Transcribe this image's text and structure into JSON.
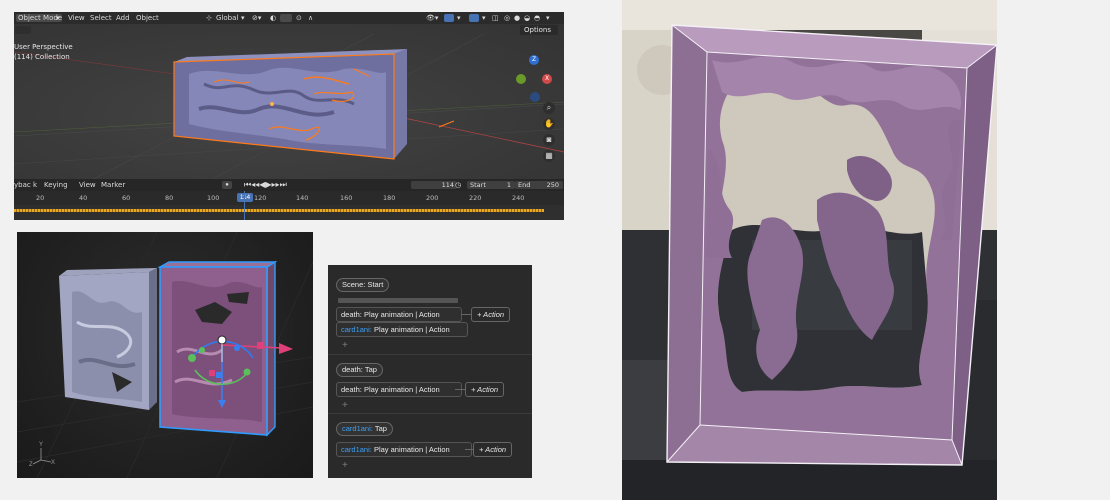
{
  "blender": {
    "header": {
      "mode": "Object Mode",
      "menus": [
        "View",
        "Select",
        "Add",
        "Object"
      ],
      "orientation": "Global",
      "options": "Options"
    },
    "viewport": {
      "view_name": "User Perspective",
      "collection": "(114) Collection",
      "gizmo": {
        "z": "Z",
        "x": "X"
      }
    },
    "timeline": {
      "menus": [
        "ybac k",
        "Keying",
        "View",
        "Marker"
      ],
      "current_frame": "114",
      "start_label": "Start",
      "start_value": "1",
      "end_label": "End",
      "end_value": "250",
      "ruler_ticks": [
        "20",
        "40",
        "60",
        "80",
        "100",
        "120",
        "140",
        "160",
        "180",
        "200",
        "220",
        "240"
      ],
      "cursor_label": "114"
    }
  },
  "model_view": {
    "axis": {
      "y": "Y",
      "z": "Z",
      "x": "X"
    }
  },
  "behaviors": {
    "sections": [
      {
        "trigger_label": "Scene:",
        "trigger_value": "Start",
        "actions": [
          {
            "object": "death:",
            "text": "Play animation | Action"
          },
          {
            "object": "card1ani:",
            "text": "Play animation | Action"
          }
        ],
        "add_action": "+ Action"
      },
      {
        "trigger_label": "death:",
        "trigger_value": "Tap",
        "actions": [
          {
            "object": "death:",
            "text": "Play animation | Action"
          }
        ],
        "add_action": "+ Action"
      },
      {
        "trigger_label": "card1ani:",
        "trigger_value": "Tap",
        "actions": [
          {
            "object": "card1ani:",
            "text": "Play animation | Action"
          }
        ],
        "add_action": "+ Action"
      }
    ],
    "add_symbol": "+"
  },
  "colors": {
    "blender_selection": "#ff7a1a",
    "card_fill": "#9a7fa2",
    "card_pink": "#8f5f8e",
    "reality_blue": "#3da0f5",
    "model_selection": "#2f9cff"
  }
}
